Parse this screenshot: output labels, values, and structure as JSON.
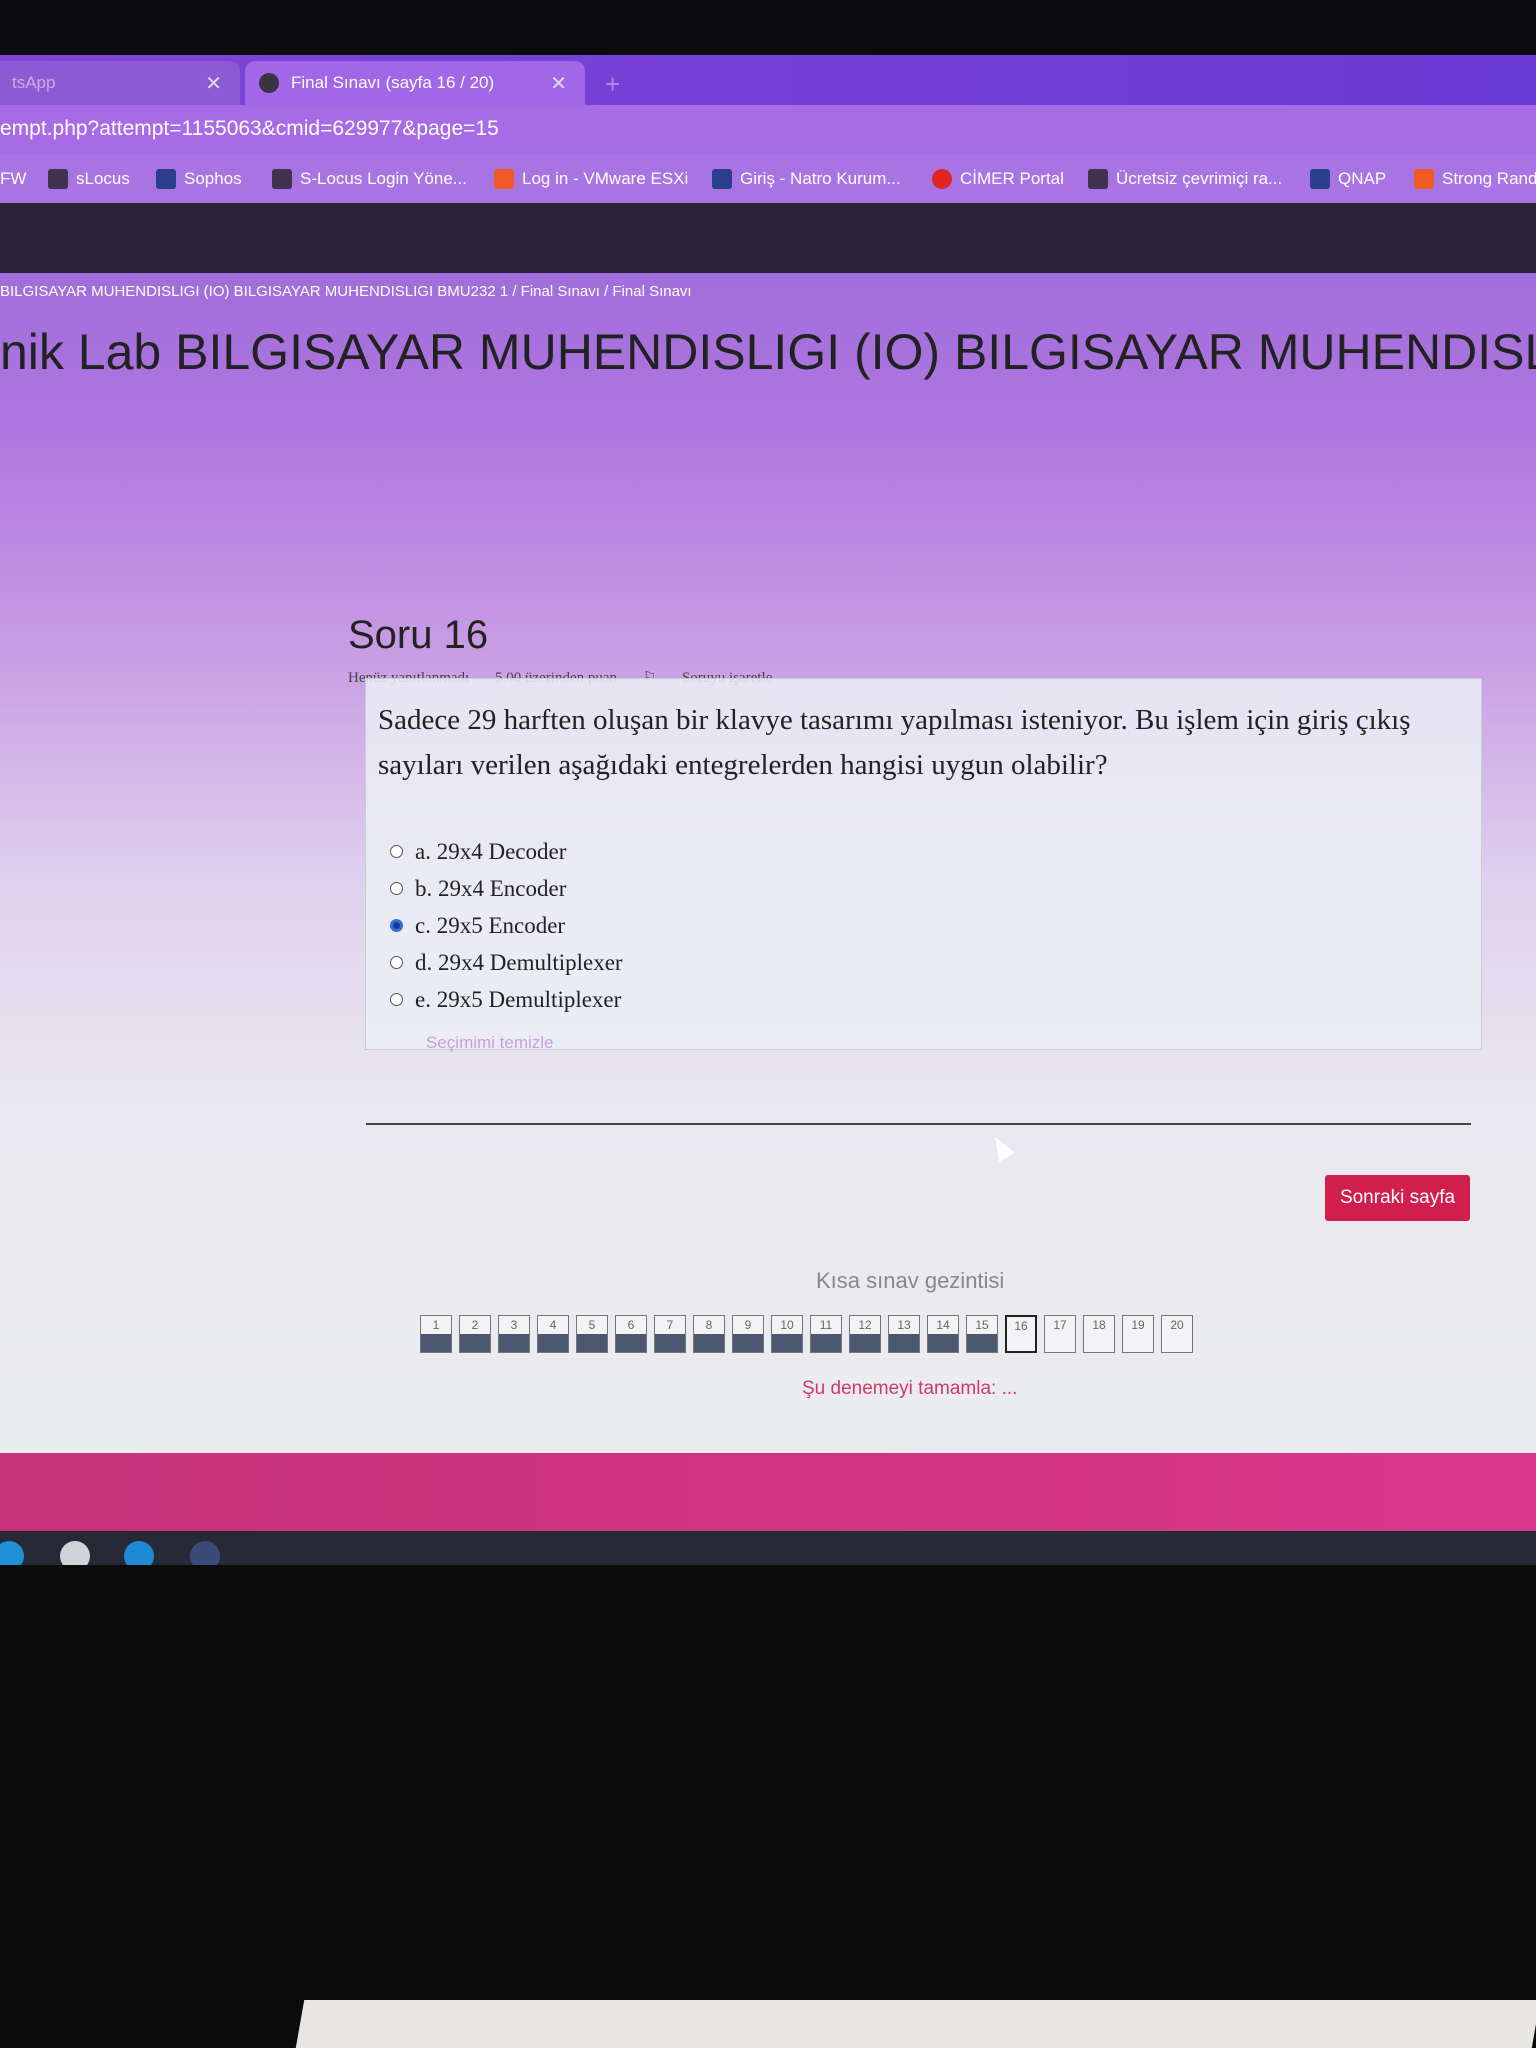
{
  "browser": {
    "tabs": [
      {
        "label": "tsApp",
        "active": false
      },
      {
        "label": "Final Sınavı (sayfa 16 / 20)",
        "active": true
      }
    ],
    "new_tab": "+",
    "url": "empt.php?attempt=1155063&cmid=629977&page=15",
    "bookmarks": [
      {
        "label": "FW",
        "icon": "bookmark-icon"
      },
      {
        "label": "sLocus",
        "icon": "slocus-icon"
      },
      {
        "label": "Sophos",
        "icon": "sophos-icon"
      },
      {
        "label": "S-Locus Login Yöne...",
        "icon": "slocus-icon"
      },
      {
        "label": "Log in - VMware ESXi",
        "icon": "vmware-icon"
      },
      {
        "label": "Giriş - Natro Kurum...",
        "icon": "natro-icon"
      },
      {
        "label": "CİMER Portal",
        "icon": "cimer-icon"
      },
      {
        "label": "Ücretsiz çevrimiçi ra...",
        "icon": "cube-icon"
      },
      {
        "label": "QNAP",
        "icon": "qnap-icon"
      },
      {
        "label": "Strong Rand",
        "icon": "strong-icon"
      }
    ]
  },
  "page": {
    "breadcrumb": "BILGISAYAR MUHENDISLIGI (IO) BILGISAYAR MUHENDISLIGI BMU232 1  /  Final Sınavı  /  Final Sınavı",
    "course_title": "nik Lab BILGISAYAR MUHENDISLIGI (IO) BILGISAYAR MUHENDISLIG"
  },
  "question": {
    "title": "Soru 16",
    "status": "Henüz yanıtlanmadı",
    "points": "5.00 üzerinden puan",
    "flag": "Soruyu işaretle",
    "text": "Sadece 29 harften oluşan bir klavye tasarımı yapılması isteniyor. Bu işlem için giriş çıkış sayıları verilen aşağıdaki entegrelerden hangisi uygun olabilir?",
    "answers": [
      {
        "label": "a. 29x4 Decoder",
        "selected": false
      },
      {
        "label": "b. 29x4 Encoder",
        "selected": false
      },
      {
        "label": "c. 29x5 Encoder",
        "selected": true
      },
      {
        "label": "d. 29x4 Demultiplexer",
        "selected": false
      },
      {
        "label": "e. 29x5 Demultiplexer",
        "selected": false
      }
    ],
    "clear_choice": "Seçimimi temizle"
  },
  "actions": {
    "next_page": "Sonraki sayfa"
  },
  "quiz_nav": {
    "title": "Kısa sınav gezintisi",
    "items": [
      "1",
      "2",
      "3",
      "4",
      "5",
      "6",
      "7",
      "8",
      "9",
      "10",
      "11",
      "12",
      "13",
      "14",
      "15",
      "16",
      "17",
      "18",
      "19",
      "20"
    ],
    "current": "16",
    "finish": "Şu denemeyi tamamla: ..."
  },
  "colors": {
    "accent": "#d01f4d",
    "selected_radio": "#2f6fd6"
  }
}
